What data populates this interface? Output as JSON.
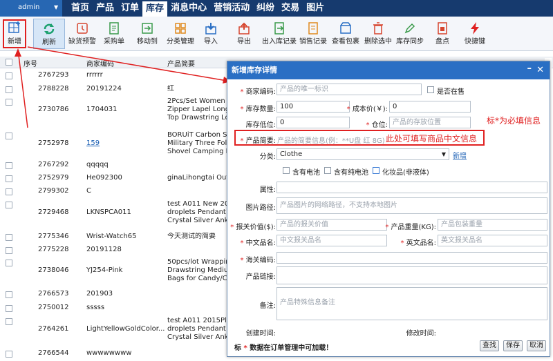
{
  "topbar": {
    "user": "admin",
    "nav": [
      "首页",
      "产品",
      "订单",
      "库存",
      "消息中心",
      "营销活动",
      "纠纷",
      "交易",
      "图片"
    ],
    "active": "库存"
  },
  "toolbar": {
    "items": [
      "新增",
      "刷新",
      "缺货预警",
      "采购单",
      "移动到",
      "分类管理",
      "导入",
      "导出",
      "出入库记录",
      "销售记录",
      "查看包裹",
      "删除选中",
      "库存同步",
      "盘点",
      "快捷键"
    ]
  },
  "grid": {
    "headers": [
      "序号",
      "商家编码",
      "产品简要"
    ],
    "rows": [
      {
        "id": "2767293",
        "code": "rrrrrr",
        "brief": ""
      },
      {
        "id": "2788228",
        "code": "20191224",
        "brief": "红"
      },
      {
        "id": "2730786",
        "code": "1704031",
        "brief": "2Pcs/Set Women T\nZipper Lapel Long\nTop Drawstring Lon"
      },
      {
        "id": "2752978",
        "code": "159",
        "brief": "BORUiT Carbon Ste\nMilitary Three Fold\nShovel Camping M"
      },
      {
        "id": "2767292",
        "code": "qqqqq",
        "brief": ""
      },
      {
        "id": "2752979",
        "code": "He092300",
        "brief": "ginaLihongtai Outd"
      },
      {
        "id": "2799302",
        "code": "C",
        "brief": ""
      },
      {
        "id": "2729468",
        "code": "LKNSPCA011",
        "brief": "test A011 New 201\ndroplets Pendant R\nCrystal Silver Ankle"
      },
      {
        "id": "2775346",
        "code": "Wrist-Watch65",
        "brief": "今天测试的简要"
      },
      {
        "id": "2775228",
        "code": "20191128",
        "brief": ""
      },
      {
        "id": "2738046",
        "code": "YJ254-Pink",
        "brief": "50pcs/lot Wrapping\nDrawstring Medium\nBags for Candy/Ch"
      },
      {
        "id": "2766573",
        "code": "201903",
        "brief": ""
      },
      {
        "id": "2750012",
        "code": "sssss",
        "brief": ""
      },
      {
        "id": "2764261",
        "code": "LightYellowGoldColor...",
        "brief": "test A011 2015Plan\ndroplets Pendant R\nCrystal Silver Ankle"
      },
      {
        "id": "2766544",
        "code": "wwwwwwww",
        "brief": ""
      }
    ]
  },
  "modal": {
    "title": "新增库存详情",
    "minimize": "–",
    "close": "✕",
    "fields": {
      "code_label": "商家编码:",
      "code_ph": "产品的唯一标识",
      "onsale_label": "是否在售",
      "qty_label": "库存数量:",
      "qty_value": "100",
      "cost_label": "成本价(￥):",
      "cost_value": "0",
      "low_label": "库存低位:",
      "low_value": "0",
      "loc_label": "仓位:",
      "loc_ph": "产品的存放位置",
      "brief_label": "产品简要:",
      "brief_ph": "产品的简要信息(例：**U盘 红 8G)",
      "cat_label": "分类:",
      "cat_value": "Clothe",
      "cat_add": "新增",
      "battery": "含有电池",
      "pure_battery": "含有纯电池",
      "cosmetic": "化妆品(非液体)",
      "attr_label": "属性:",
      "img_label": "图片路径:",
      "img_ph": "产品图片的网络路径，不支持本地图片",
      "declare_label": "报关价值($):",
      "declare_ph": "产品的报关价值",
      "weight_label": "产品重量(KG):",
      "weight_ph": "产品包装重量",
      "cn_label": "中文品名:",
      "cn_ph": "中文报关品名",
      "en_label": "英文品名:",
      "en_ph": "英文报关品名",
      "hs_label": "海关编码:",
      "link_label": "产品链接:",
      "note_label": "备注:",
      "note_ph": "产品特殊信息备注",
      "created_label": "创建时间:",
      "modified_label": "修改时间:"
    },
    "footer_note": "数据在订单管理中可加载！",
    "footer_prefix": "标",
    "buttons": [
      "查找",
      "保存",
      "取消"
    ]
  },
  "annotations": {
    "required_note": "标*为必填信息",
    "brief_note": "此处可填写商品中文信息"
  }
}
